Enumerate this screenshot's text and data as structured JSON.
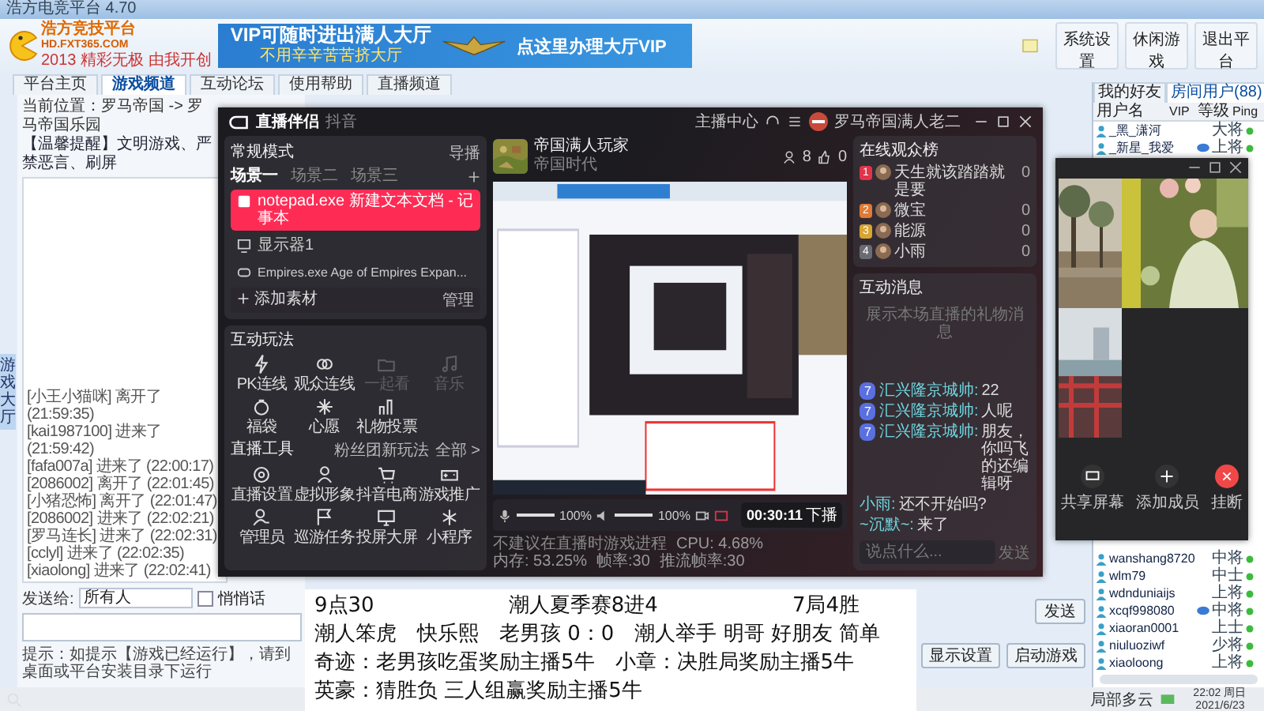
{
  "host_window": {
    "title": "浩方电竞平台 4.70",
    "logo": {
      "name": "浩方竞技平台",
      "site": "HD.FXT365.COM",
      "slogan": "2013 精彩无极 由我开创"
    },
    "banner": {
      "headline": "VIP可随时进出满人大厅",
      "subline": "不用辛辛苦苦挤大厅",
      "cta": "点这里办理大厅VIP"
    },
    "toolbar_buttons": [
      "系统设置",
      "休闲游戏",
      "退出平台"
    ],
    "tabs": [
      {
        "label": "平台主页",
        "selected": false
      },
      {
        "label": "游戏频道",
        "selected": true
      },
      {
        "label": "互动论坛",
        "selected": false
      },
      {
        "label": "使用帮助",
        "selected": false
      },
      {
        "label": "直播频道",
        "selected": false
      }
    ],
    "breadcrumb": "当前位置：罗马帝国 -> 罗马帝国乐园",
    "notice": "【温馨提醒】文明游戏、严禁恶言、刷屏",
    "side_tab": "游戏大厅",
    "chat_log": [
      "[小王小猫咪] 离开了 (21:59:35)",
      "[kai1987100] 进来了 (21:59:42)",
      "[fafa007a] 进来了 (22:00:17)",
      "[2086002] 离开了 (22:01:45)",
      "[小猪恐怖] 离开了 (22:01:47)",
      "[2086002] 进来了 (22:02:21)",
      "[罗马连长] 进来了 (22:02:31)",
      "[cclyl] 进来了 (22:02:35)",
      "[xiaolong] 进来了 (22:02:41)"
    ],
    "send_to": {
      "label": "发送给:",
      "value": "所有人"
    },
    "whisper": {
      "label": "悄悄话",
      "checked": false
    },
    "hint": "提示：如提示【游戏已经运行】，请到桌面或平台安装目录下运行",
    "send_button": "发送",
    "bottom_buttons": [
      "显示设置",
      "启动游戏"
    ],
    "user_list": {
      "tabs": [
        {
          "label": "我的好友",
          "selected": false
        },
        {
          "label": "房间用户(88)",
          "selected": true
        }
      ],
      "columns": [
        "用户名",
        "VIP",
        "等级",
        "Ping"
      ],
      "rows_top": [
        {
          "name": "_黑_潇河",
          "rank": "大将",
          "vip": false
        },
        {
          "name": "_新星_我爱",
          "rank": "上将",
          "vip": true
        }
      ],
      "rows_bottom": [
        {
          "name": "wanshang8720",
          "rank": "中将",
          "vip": false
        },
        {
          "name": "wlm79",
          "rank": "中士",
          "vip": false
        },
        {
          "name": "wdnduniaijs",
          "rank": "上将",
          "vip": false
        },
        {
          "name": "xcqf998080",
          "rank": "中将",
          "vip": true
        },
        {
          "name": "xiaoran0001",
          "rank": "上士",
          "vip": false
        },
        {
          "name": "niuluoziwf",
          "rank": "少将",
          "vip": false
        },
        {
          "name": "xiaoloong",
          "rank": "上将",
          "vip": false
        }
      ]
    }
  },
  "streaming_app": {
    "brand": "直播伴侣",
    "platform": "抖音",
    "anchor_center": "主播中心",
    "user": "罗马帝国满人老二",
    "mode": "常规模式",
    "director": "导播",
    "scenes": [
      {
        "label": "场景一",
        "selected": true
      },
      {
        "label": "场景二",
        "selected": false
      },
      {
        "label": "场景三",
        "selected": false
      }
    ],
    "sources": [
      {
        "label": "notepad.exe 新建文本文档 - 记事本",
        "kind": "window",
        "selected": true
      },
      {
        "label": "显示器1",
        "kind": "monitor",
        "selected": false
      },
      {
        "label": "Empires.exe Age of Empires Expan...",
        "kind": "game",
        "selected": false
      }
    ],
    "add_source": "添加素材",
    "manage": "管理",
    "play_title": "互动玩法",
    "play_items": [
      {
        "label": "PK连线",
        "disabled": false
      },
      {
        "label": "观众连线",
        "disabled": false
      },
      {
        "label": "一起看",
        "disabled": true
      },
      {
        "label": "音乐",
        "disabled": true
      },
      {
        "label": "福袋",
        "disabled": false
      },
      {
        "label": "心愿",
        "disabled": false
      },
      {
        "label": "礼物投票",
        "disabled": false
      }
    ],
    "tools_title": "直播工具",
    "tools_promo": "粉丝团新玩法",
    "tools_all": "全部 >",
    "tools": [
      "直播设置",
      "虚拟形象",
      "抖音电商",
      "游戏推广",
      "管理员",
      "巡游任务",
      "投屏大屏",
      "小程序"
    ],
    "room": {
      "title": "帝国满人玩家",
      "category": "帝国时代",
      "viewers": "8",
      "likes": "0"
    },
    "mic": {
      "level": 1,
      "reading": "100%"
    },
    "speaker": {
      "level": 1,
      "reading": "100%"
    },
    "timer": "00:30:11",
    "end_button": "下播",
    "tip": "不建议在直播时游戏进程",
    "stats": [
      "CPU: 4.68%",
      "内存: 53.25%",
      "帧率:30",
      "推流帧率:30"
    ],
    "audience_title": "在线观众榜",
    "audience": [
      {
        "rank": "1",
        "name": "天生就该踏踏就是要",
        "score": "0",
        "color": "#e0344a"
      },
      {
        "rank": "2",
        "name": "微宝",
        "score": "0",
        "color": "#e07a34"
      },
      {
        "rank": "3",
        "name": "能源",
        "score": "0",
        "color": "#d9a531"
      },
      {
        "rank": "4",
        "name": "小雨",
        "score": "0",
        "color": "#6b6b73"
      }
    ],
    "messages_title": "互动消息",
    "messages_empty": "展示本场直播的礼物消息",
    "messages": [
      {
        "level": "7",
        "name": "汇兴隆京城帅:",
        "text": "22"
      },
      {
        "level": "7",
        "name": "汇兴隆京城帅:",
        "text": "人呢"
      },
      {
        "level": "7",
        "name": "汇兴隆京城帅:",
        "text": "朋友，你吗飞的还编辑呀"
      },
      {
        "name": "小雨:",
        "text": "还不开始吗?"
      },
      {
        "name": "~沉默~:",
        "text": "来了"
      }
    ],
    "input_placeholder": "说点什么...",
    "send": "发送"
  },
  "video_call": {
    "buttons": [
      {
        "label": "共享屏幕",
        "kind": "screen"
      },
      {
        "label": "添加成员",
        "kind": "add"
      },
      {
        "label": "挂断",
        "kind": "hangup"
      }
    ]
  },
  "overlay_text": {
    "header": [
      "9点30",
      "潮人夏季赛8进4",
      "7局4胜"
    ],
    "lines": [
      "潮人笨虎　快乐熙　老男孩 0：0　潮人举手 明哥 好朋友 简单",
      "奇迹：老男孩吃蛋奖励主播5牛　小章：决胜局奖励主播5牛",
      "英豪：猜胜负 三人组赢奖励主播5牛"
    ]
  },
  "taskbar": {
    "weather": "局部多云",
    "time": "22:02 周日",
    "date": "2021/6/23"
  }
}
